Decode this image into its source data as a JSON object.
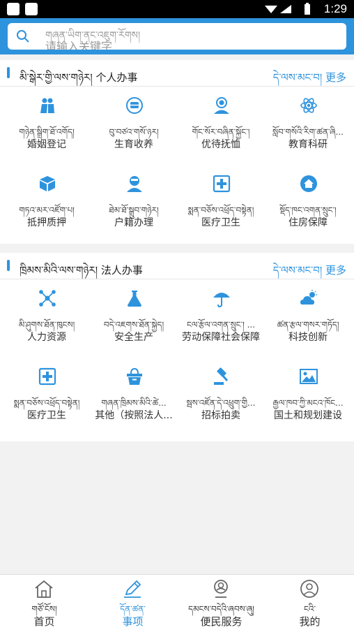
{
  "status_bar": {
    "time": "1:29"
  },
  "search": {
    "placeholder_tibetan": "གཞན་ཡིག་ནང་འཇུག་རོགས།",
    "placeholder_chinese": "请输入关键字"
  },
  "sections": [
    {
      "title": "མི་སྒེར་གྱི་ལས་གཉེར། 个人办事",
      "more": "དེ་ལས་མང་བ། 更多",
      "items": [
        {
          "tib": "གཉེན་སྒྲིག་ཐོ་འགོད།",
          "cn": "婚姻登记",
          "icon": "couple-icon"
        },
        {
          "tib": "བུ་བཙའ་གསོ་ཉར།",
          "cn": "生育收养",
          "icon": "baby-bottle-icon"
        },
        {
          "tib": "གོང་སོར་བཞིན་སྐྱོང་།",
          "cn": "优待抚恤",
          "icon": "care-person-icon"
        },
        {
          "tib": "སློབ་གསོའི་རིག་ཚན་ཞི...",
          "cn": "教育科研",
          "icon": "atom-icon"
        },
        {
          "tib": "གཏའ་མར་འཛོག་པ།",
          "cn": "抵押质押",
          "icon": "box-icon"
        },
        {
          "tib": "ཐེམ་ཐོ་སྒྲུབ་གཉེར།",
          "cn": "户籍办理",
          "icon": "id-person-icon"
        },
        {
          "tib": "སྨན་བཅོས་འཕྲོད་བསྟེན།",
          "cn": "医疗卫生",
          "icon": "medical-cross-icon"
        },
        {
          "tib": "སྡོད་ཁང་འགན་སྲུང་།",
          "cn": "住房保障",
          "icon": "house-icon"
        }
      ]
    },
    {
      "title": "ཁྲིམས་མིའི་ལས་གཉེར། 法人办事",
      "more": "དེ་ལས་མང་བ། 更多",
      "items": [
        {
          "tib": "མི་ཤུགས་ཐོན་ཁུངས།",
          "cn": "人力资源",
          "icon": "network-icon"
        },
        {
          "tib": "བདེ་འཇགས་ཐོན་སྐྱེད།",
          "cn": "安全生产",
          "icon": "flask-icon"
        },
        {
          "tib": "ངལ་རྩོལ་འགན་སྲུང་། ...",
          "cn": "劳动保障社会保障",
          "icon": "umbrella-icon"
        },
        {
          "tib": "ཚན་རྩལ་གསར་གཏོད།",
          "cn": "科技创新",
          "icon": "cloud-sun-icon"
        },
        {
          "tib": "སྨན་བཅོས་འཕྲོད་བསྟེན།",
          "cn": "医疗卫生",
          "icon": "medical-cross-icon"
        },
        {
          "tib": "གཞན་ཁྲིམས་མིའི་ཚེ...",
          "cn": "其他（按照法人...",
          "icon": "basket-icon"
        },
        {
          "tib": "སྦས་འཛོན་དེ་འཕྲུག་གྱི...",
          "cn": "招标拍卖",
          "icon": "gavel-icon"
        },
        {
          "tib": "རྒྱལ་ཁབ་ཀྱི་མངའ་ཁོང...",
          "cn": "国土和规划建设",
          "icon": "picture-icon"
        }
      ]
    }
  ],
  "tabs": [
    {
      "tib": "གཙོ་ངོས།",
      "cn": "首页",
      "icon": "home-icon",
      "active": false
    },
    {
      "tib": "དོན་ཚན་",
      "cn": "事项",
      "icon": "pencil-icon",
      "active": true
    },
    {
      "tib": "དམངས་བདེའི་ཞབས་ཞུ།",
      "cn": "便民服务",
      "icon": "service-icon",
      "active": false
    },
    {
      "tib": "ངའི་",
      "cn": "我的",
      "icon": "user-icon",
      "active": false
    }
  ],
  "colors": {
    "accent": "#2e93dd",
    "background": "#f2f2f2"
  }
}
